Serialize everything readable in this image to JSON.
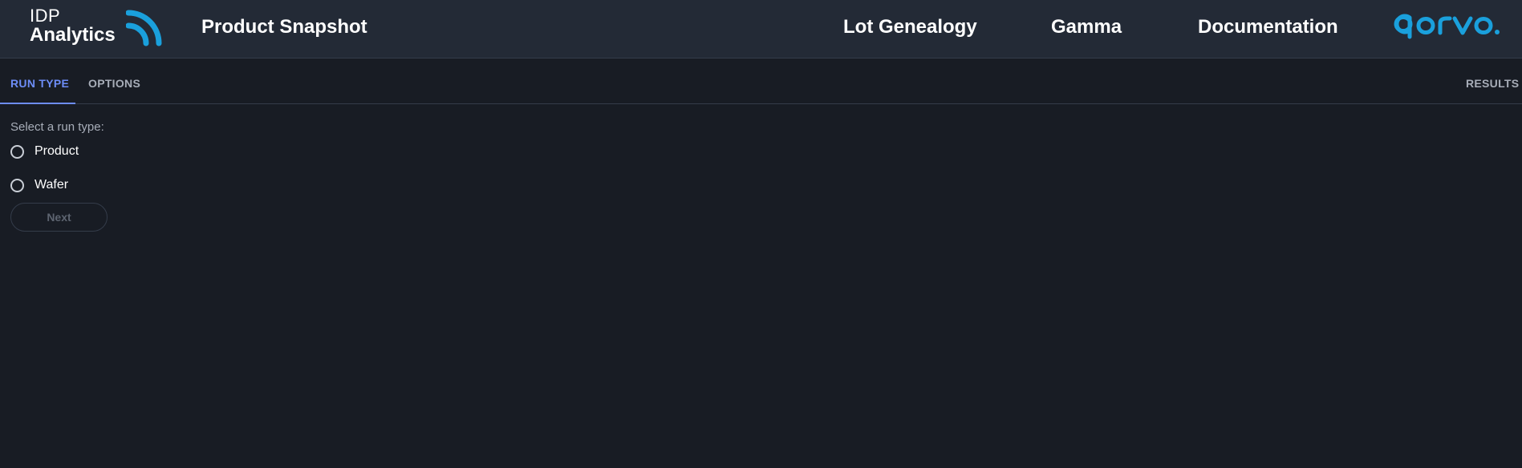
{
  "header": {
    "brand_line1": "IDP",
    "brand_line2": "Analytics",
    "page_title": "Product Snapshot",
    "nav": [
      "Lot Genealogy",
      "Gamma",
      "Documentation"
    ],
    "logo_text": "qorvo",
    "logo_color": "#1aa0dc",
    "icon_color": "#1aa0dc"
  },
  "tabs": {
    "run_type": "RUN TYPE",
    "options": "OPTIONS",
    "results": "RESULTS",
    "active": "RUN TYPE",
    "accent_color": "#6d8df7"
  },
  "form": {
    "prompt": "Select a run type:",
    "options": [
      "Product",
      "Wafer"
    ],
    "selected": null,
    "next_label": "Next",
    "next_enabled": false
  }
}
